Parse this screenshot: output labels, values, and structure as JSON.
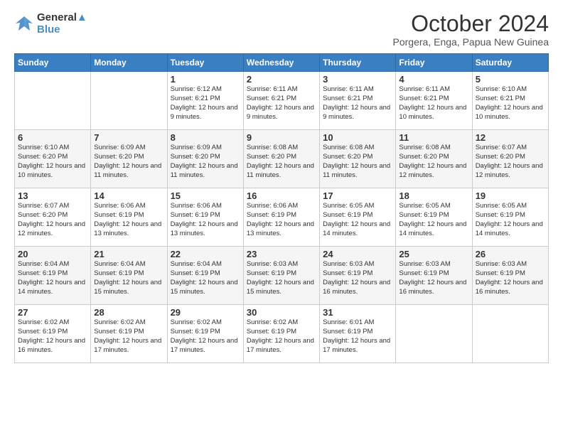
{
  "logo": {
    "line1": "General",
    "line2": "Blue"
  },
  "title": "October 2024",
  "subtitle": "Porgera, Enga, Papua New Guinea",
  "weekdays": [
    "Sunday",
    "Monday",
    "Tuesday",
    "Wednesday",
    "Thursday",
    "Friday",
    "Saturday"
  ],
  "weeks": [
    [
      {
        "day": "",
        "info": ""
      },
      {
        "day": "",
        "info": ""
      },
      {
        "day": "1",
        "info": "Sunrise: 6:12 AM\nSunset: 6:21 PM\nDaylight: 12 hours and 9 minutes."
      },
      {
        "day": "2",
        "info": "Sunrise: 6:11 AM\nSunset: 6:21 PM\nDaylight: 12 hours and 9 minutes."
      },
      {
        "day": "3",
        "info": "Sunrise: 6:11 AM\nSunset: 6:21 PM\nDaylight: 12 hours and 9 minutes."
      },
      {
        "day": "4",
        "info": "Sunrise: 6:11 AM\nSunset: 6:21 PM\nDaylight: 12 hours and 10 minutes."
      },
      {
        "day": "5",
        "info": "Sunrise: 6:10 AM\nSunset: 6:21 PM\nDaylight: 12 hours and 10 minutes."
      }
    ],
    [
      {
        "day": "6",
        "info": "Sunrise: 6:10 AM\nSunset: 6:20 PM\nDaylight: 12 hours and 10 minutes."
      },
      {
        "day": "7",
        "info": "Sunrise: 6:09 AM\nSunset: 6:20 PM\nDaylight: 12 hours and 11 minutes."
      },
      {
        "day": "8",
        "info": "Sunrise: 6:09 AM\nSunset: 6:20 PM\nDaylight: 12 hours and 11 minutes."
      },
      {
        "day": "9",
        "info": "Sunrise: 6:08 AM\nSunset: 6:20 PM\nDaylight: 12 hours and 11 minutes."
      },
      {
        "day": "10",
        "info": "Sunrise: 6:08 AM\nSunset: 6:20 PM\nDaylight: 12 hours and 11 minutes."
      },
      {
        "day": "11",
        "info": "Sunrise: 6:08 AM\nSunset: 6:20 PM\nDaylight: 12 hours and 12 minutes."
      },
      {
        "day": "12",
        "info": "Sunrise: 6:07 AM\nSunset: 6:20 PM\nDaylight: 12 hours and 12 minutes."
      }
    ],
    [
      {
        "day": "13",
        "info": "Sunrise: 6:07 AM\nSunset: 6:20 PM\nDaylight: 12 hours and 12 minutes."
      },
      {
        "day": "14",
        "info": "Sunrise: 6:06 AM\nSunset: 6:19 PM\nDaylight: 12 hours and 13 minutes."
      },
      {
        "day": "15",
        "info": "Sunrise: 6:06 AM\nSunset: 6:19 PM\nDaylight: 12 hours and 13 minutes."
      },
      {
        "day": "16",
        "info": "Sunrise: 6:06 AM\nSunset: 6:19 PM\nDaylight: 12 hours and 13 minutes."
      },
      {
        "day": "17",
        "info": "Sunrise: 6:05 AM\nSunset: 6:19 PM\nDaylight: 12 hours and 14 minutes."
      },
      {
        "day": "18",
        "info": "Sunrise: 6:05 AM\nSunset: 6:19 PM\nDaylight: 12 hours and 14 minutes."
      },
      {
        "day": "19",
        "info": "Sunrise: 6:05 AM\nSunset: 6:19 PM\nDaylight: 12 hours and 14 minutes."
      }
    ],
    [
      {
        "day": "20",
        "info": "Sunrise: 6:04 AM\nSunset: 6:19 PM\nDaylight: 12 hours and 14 minutes."
      },
      {
        "day": "21",
        "info": "Sunrise: 6:04 AM\nSunset: 6:19 PM\nDaylight: 12 hours and 15 minutes."
      },
      {
        "day": "22",
        "info": "Sunrise: 6:04 AM\nSunset: 6:19 PM\nDaylight: 12 hours and 15 minutes."
      },
      {
        "day": "23",
        "info": "Sunrise: 6:03 AM\nSunset: 6:19 PM\nDaylight: 12 hours and 15 minutes."
      },
      {
        "day": "24",
        "info": "Sunrise: 6:03 AM\nSunset: 6:19 PM\nDaylight: 12 hours and 16 minutes."
      },
      {
        "day": "25",
        "info": "Sunrise: 6:03 AM\nSunset: 6:19 PM\nDaylight: 12 hours and 16 minutes."
      },
      {
        "day": "26",
        "info": "Sunrise: 6:03 AM\nSunset: 6:19 PM\nDaylight: 12 hours and 16 minutes."
      }
    ],
    [
      {
        "day": "27",
        "info": "Sunrise: 6:02 AM\nSunset: 6:19 PM\nDaylight: 12 hours and 16 minutes."
      },
      {
        "day": "28",
        "info": "Sunrise: 6:02 AM\nSunset: 6:19 PM\nDaylight: 12 hours and 17 minutes."
      },
      {
        "day": "29",
        "info": "Sunrise: 6:02 AM\nSunset: 6:19 PM\nDaylight: 12 hours and 17 minutes."
      },
      {
        "day": "30",
        "info": "Sunrise: 6:02 AM\nSunset: 6:19 PM\nDaylight: 12 hours and 17 minutes."
      },
      {
        "day": "31",
        "info": "Sunrise: 6:01 AM\nSunset: 6:19 PM\nDaylight: 12 hours and 17 minutes."
      },
      {
        "day": "",
        "info": ""
      },
      {
        "day": "",
        "info": ""
      }
    ]
  ]
}
